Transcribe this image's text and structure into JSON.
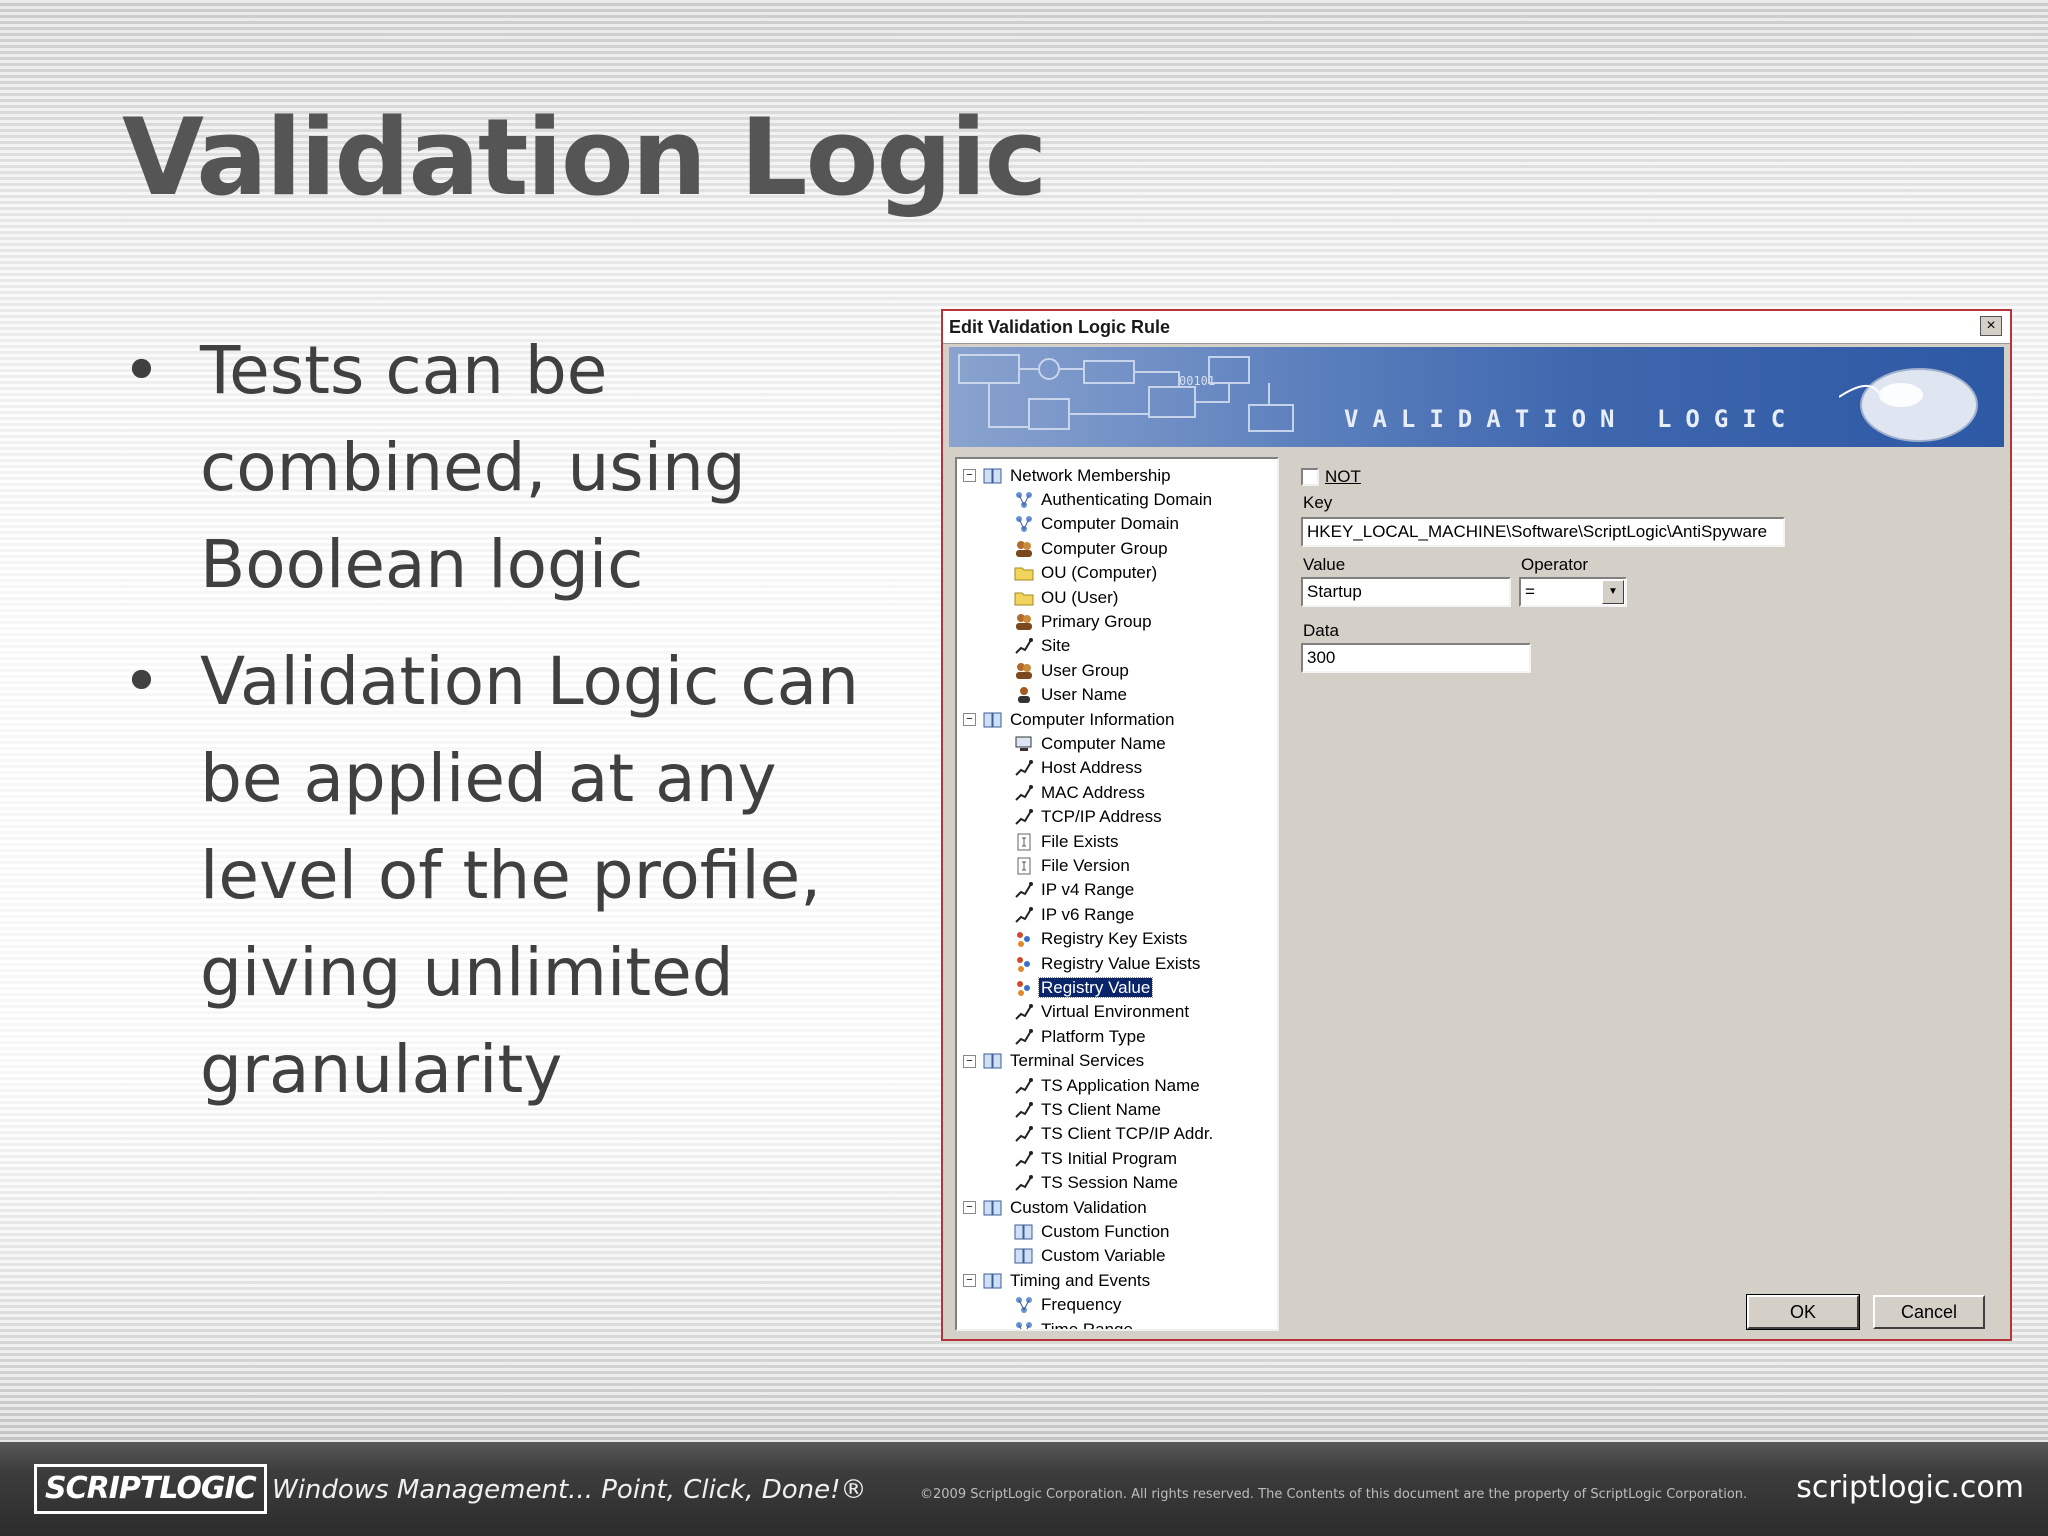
{
  "slide": {
    "title": "Validation Logic",
    "bullets": [
      "Tests can be combined, using Boolean logic",
      "Validation Logic can be applied at any level of the profile, giving unlimited granularity"
    ]
  },
  "dialog": {
    "title": "Edit Validation Logic Rule",
    "close_label": "×",
    "banner_text": "VALIDATION LOGIC",
    "tree": [
      {
        "label": "Network Membership",
        "level": 0,
        "icon": "book-icon",
        "expanded": true
      },
      {
        "label": "Authenticating Domain",
        "level": 1,
        "icon": "network-icon"
      },
      {
        "label": "Computer Domain",
        "level": 1,
        "icon": "network-icon"
      },
      {
        "label": "Computer Group",
        "level": 1,
        "icon": "group-icon"
      },
      {
        "label": "OU (Computer)",
        "level": 1,
        "icon": "folder-icon"
      },
      {
        "label": "OU (User)",
        "level": 1,
        "icon": "folder-icon"
      },
      {
        "label": "Primary Group",
        "level": 1,
        "icon": "group-icon"
      },
      {
        "label": "Site",
        "level": 1,
        "icon": "connector-icon"
      },
      {
        "label": "User Group",
        "level": 1,
        "icon": "group-icon"
      },
      {
        "label": "User Name",
        "level": 1,
        "icon": "user-icon"
      },
      {
        "label": "Computer Information",
        "level": 0,
        "icon": "book-icon",
        "expanded": true
      },
      {
        "label": "Computer Name",
        "level": 1,
        "icon": "computer-icon"
      },
      {
        "label": "Host Address",
        "level": 1,
        "icon": "connector-icon"
      },
      {
        "label": "MAC Address",
        "level": 1,
        "icon": "connector-icon"
      },
      {
        "label": "TCP/IP Address",
        "level": 1,
        "icon": "connector-icon"
      },
      {
        "label": "File Exists",
        "level": 1,
        "icon": "file-icon"
      },
      {
        "label": "File Version",
        "level": 1,
        "icon": "file-icon"
      },
      {
        "label": "IP v4 Range",
        "level": 1,
        "icon": "connector-icon"
      },
      {
        "label": "IP v6 Range",
        "level": 1,
        "icon": "connector-icon"
      },
      {
        "label": "Registry Key Exists",
        "level": 1,
        "icon": "registry-icon"
      },
      {
        "label": "Registry Value Exists",
        "level": 1,
        "icon": "registry-icon"
      },
      {
        "label": "Registry Value",
        "level": 1,
        "icon": "registry-icon",
        "selected": true
      },
      {
        "label": "Virtual Environment",
        "level": 1,
        "icon": "connector-icon"
      },
      {
        "label": "Platform Type",
        "level": 1,
        "icon": "connector-icon"
      },
      {
        "label": "Terminal Services",
        "level": 0,
        "icon": "book-icon",
        "expanded": true
      },
      {
        "label": "TS Application Name",
        "level": 1,
        "icon": "connector-icon"
      },
      {
        "label": "TS Client Name",
        "level": 1,
        "icon": "connector-icon"
      },
      {
        "label": "TS Client TCP/IP Addr.",
        "level": 1,
        "icon": "connector-icon"
      },
      {
        "label": "TS Initial Program",
        "level": 1,
        "icon": "connector-icon"
      },
      {
        "label": "TS Session Name",
        "level": 1,
        "icon": "connector-icon"
      },
      {
        "label": "Custom Validation",
        "level": 0,
        "icon": "book-icon",
        "expanded": true
      },
      {
        "label": "Custom Function",
        "level": 1,
        "icon": "book-icon"
      },
      {
        "label": "Custom Variable",
        "level": 1,
        "icon": "book-icon"
      },
      {
        "label": "Timing and Events",
        "level": 0,
        "icon": "book-icon",
        "expanded": true
      },
      {
        "label": "Frequency",
        "level": 1,
        "icon": "network-icon"
      },
      {
        "label": "Time Range",
        "level": 1,
        "icon": "network-icon"
      }
    ],
    "form": {
      "not_label": "NOT",
      "not_checked": false,
      "key_label": "Key",
      "key_value": "HKEY_LOCAL_MACHINE\\Software\\ScriptLogic\\AntiSpyware",
      "value_label": "Value",
      "value_value": "Startup",
      "operator_label": "Operator",
      "operator_value": "=",
      "data_label": "Data",
      "data_value": "300"
    },
    "buttons": {
      "ok": "OK",
      "cancel": "Cancel"
    }
  },
  "footer": {
    "logo": "SCRIPTLOGIC",
    "tagline": "Windows Management... Point, Click, Done!®",
    "copyright": "©2009 ScriptLogic Corporation. All rights reserved. The Contents of this document are the property of ScriptLogic Corporation.",
    "site": "scriptlogic.com"
  },
  "colors": {
    "title": "#555555",
    "selection": "#0a246a",
    "banner": "#3f67ae",
    "dialog_face": "#d4d0c8"
  }
}
